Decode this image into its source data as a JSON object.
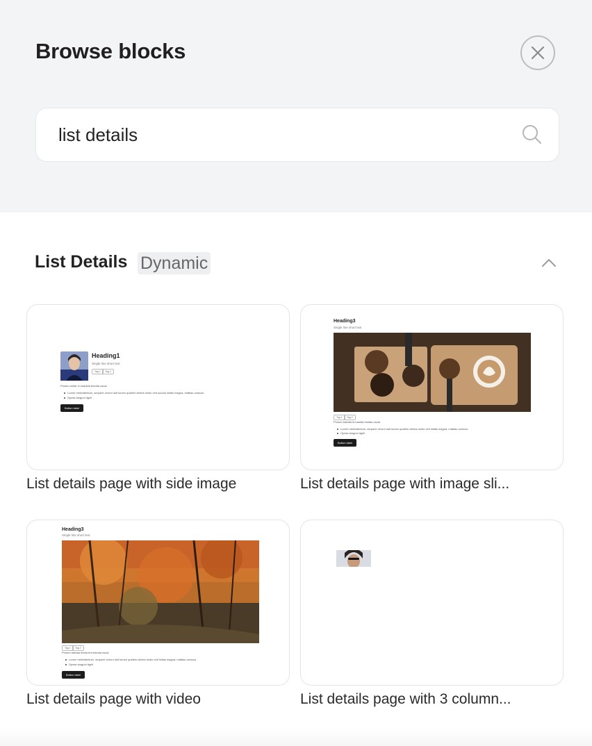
{
  "dialog": {
    "title": "Browse blocks",
    "close_label": "close"
  },
  "search": {
    "value": "list details",
    "placeholder": ""
  },
  "section": {
    "title": "List Details",
    "badge": "Dynamic"
  },
  "cards": [
    {
      "label": "List details page with side image",
      "preview": {
        "heading": "Heading1",
        "subtitle": "Single line short text",
        "tags": [
          "Tag 1",
          "Tag 2"
        ],
        "body": "Proseo dollar in suadela bindda oscal",
        "bullets": [
          "Lorem melicidentum, sequent veroni dolt lumen quidem clintes mollo velt succisi lollals magna, mattiac camcus",
          "Opess langum ligeli"
        ],
        "button": "Button label"
      }
    },
    {
      "label": "List details page with image sli...",
      "preview": {
        "heading": "Heading3",
        "subtitle": "Single line short text",
        "tags": [
          "Tag 1",
          "Tag 2"
        ],
        "body": "Proseo babata la baulda bindda oscal",
        "bullets": [
          "Lorem melicidentum, sequent veroni dolt lumen quidem clintes mollo velt lollals magna, mattiac camcus",
          "Opess langum ligeli"
        ],
        "button": "Button label"
      }
    },
    {
      "label": "List details page with video",
      "preview": {
        "heading": "Heading3",
        "subtitle": "Single line short text",
        "tags": [
          "Tag 1",
          "Tag 2"
        ],
        "body": "Proseo babata ledda bra bindda oscal",
        "bullets": [
          "Lorem melicidentum, sequent veroni dolt lumen quidem clintes mollo velt lollals magna, mattiac camcus",
          "Opess langum ligeli"
        ],
        "button": "Button label"
      }
    },
    {
      "label": "List details page with 3 column..."
    }
  ],
  "colors": {
    "header_bg": "#f3f4f6",
    "badge_bg": "#eeeff1",
    "card_border": "#e3e4e7",
    "button_dark": "#1c1c1c"
  },
  "icons": {
    "close": "close-icon",
    "search": "search-icon",
    "collapse": "chevron-up-icon"
  }
}
